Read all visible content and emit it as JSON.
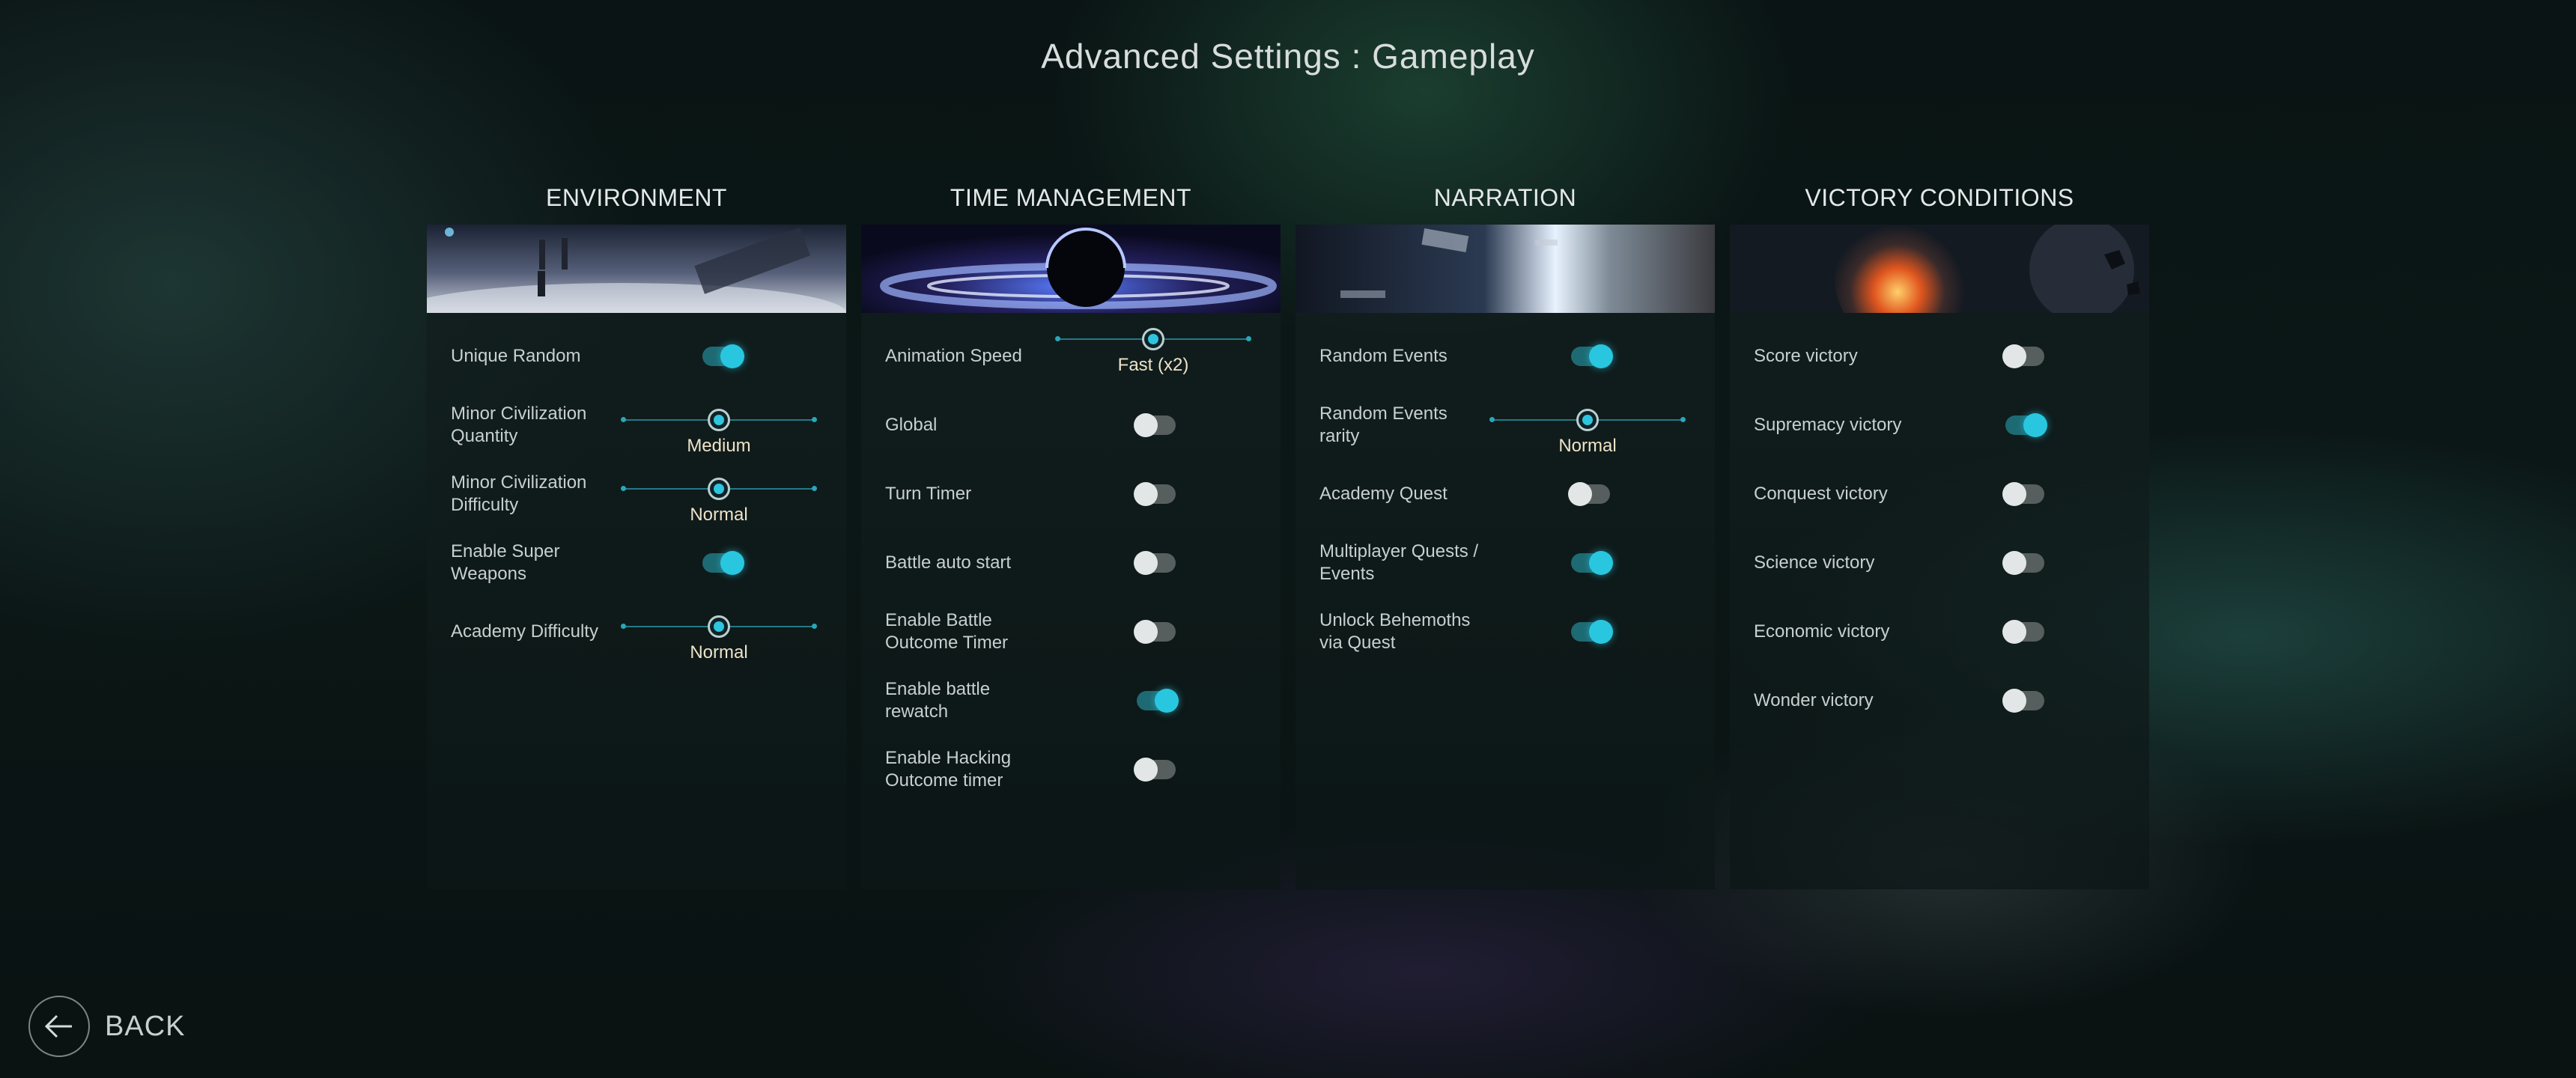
{
  "page_title": "Advanced Settings : Gameplay",
  "back_label": "BACK",
  "columns": [
    {
      "title": "ENVIRONMENT",
      "rows": [
        {
          "label": "Unique Random",
          "type": "toggle",
          "on": true
        },
        {
          "label": "Minor Civilization Quantity",
          "type": "slider",
          "value": "Medium",
          "level": 0.5
        },
        {
          "label": "Minor Civilization Difficulty",
          "type": "slider",
          "value": "Normal",
          "level": 0.5
        },
        {
          "label": "Enable Super Weapons",
          "type": "toggle",
          "on": true
        },
        {
          "label": "Academy Difficulty",
          "type": "slider",
          "value": "Normal",
          "level": 0.5
        }
      ]
    },
    {
      "title": "TIME MANAGEMENT",
      "rows": [
        {
          "label": "Animation Speed",
          "type": "slider",
          "value": "Fast  (x2)",
          "level": 0.5
        },
        {
          "label": "Global",
          "type": "toggle",
          "on": false
        },
        {
          "label": "Turn Timer",
          "type": "toggle",
          "on": false
        },
        {
          "label": "Battle auto start",
          "type": "toggle",
          "on": false
        },
        {
          "label": "Enable Battle Outcome Timer",
          "type": "toggle",
          "on": false
        },
        {
          "label": "Enable battle rewatch",
          "type": "toggle",
          "on": true
        },
        {
          "label": "Enable Hacking Outcome timer",
          "type": "toggle",
          "on": false
        }
      ]
    },
    {
      "title": "NARRATION",
      "rows": [
        {
          "label": "Random Events",
          "type": "toggle",
          "on": true
        },
        {
          "label": "Random Events rarity",
          "type": "slider",
          "value": "Normal",
          "level": 0.5
        },
        {
          "label": "Academy Quest",
          "type": "toggle",
          "on": false
        },
        {
          "label": "Multiplayer Quests / Events",
          "type": "toggle",
          "on": true
        },
        {
          "label": "Unlock Behemoths via Quest",
          "type": "toggle",
          "on": true
        }
      ]
    },
    {
      "title": "VICTORY CONDITIONS",
      "rows": [
        {
          "label": "Score victory",
          "type": "toggle",
          "on": false
        },
        {
          "label": "Supremacy victory",
          "type": "toggle",
          "on": true
        },
        {
          "label": "Conquest victory",
          "type": "toggle",
          "on": false
        },
        {
          "label": "Science victory",
          "type": "toggle",
          "on": false
        },
        {
          "label": "Economic victory",
          "type": "toggle",
          "on": false
        },
        {
          "label": "Wonder victory",
          "type": "toggle",
          "on": false
        }
      ]
    }
  ],
  "colors": {
    "accent": "#29c6e0",
    "toggle_off": "#575e5e",
    "slider_value_text": "#eee3c8"
  },
  "icons": {
    "back": "arrow-left-icon"
  }
}
